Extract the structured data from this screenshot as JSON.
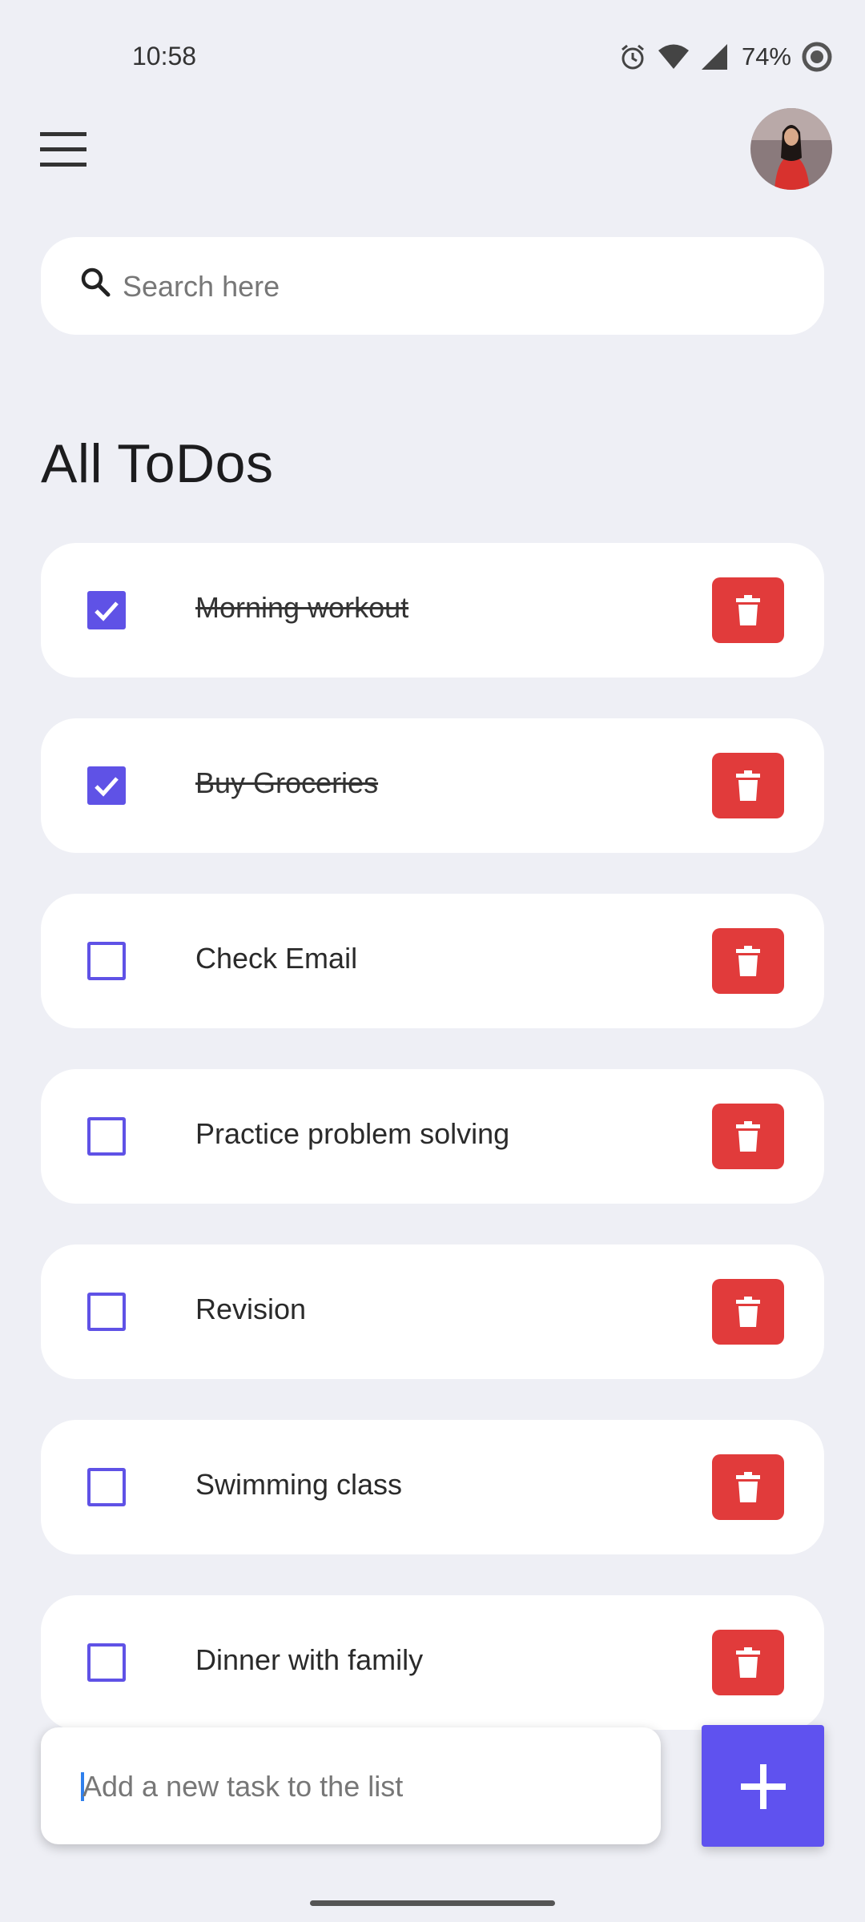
{
  "status_bar": {
    "time": "10:58",
    "battery": "74%",
    "icons": [
      "alarm-icon",
      "wifi-icon",
      "signal-icon",
      "battery-icon"
    ]
  },
  "header": {
    "menu_icon": "hamburger-menu-icon",
    "avatar": "profile-avatar"
  },
  "search": {
    "placeholder": "Search here",
    "value": ""
  },
  "section_title": "All ToDos",
  "todos": [
    {
      "text": "Morning workout",
      "done": true
    },
    {
      "text": "Buy Groceries",
      "done": true
    },
    {
      "text": "Check Email",
      "done": false
    },
    {
      "text": "Practice problem solving",
      "done": false
    },
    {
      "text": "Revision",
      "done": false
    },
    {
      "text": "Swimming class",
      "done": false
    },
    {
      "text": "Dinner with family",
      "done": false
    }
  ],
  "new_task": {
    "placeholder": "Add a new task to the list",
    "value": ""
  },
  "colors": {
    "accent": "#5f52ef",
    "delete": "#e13b3b",
    "background": "#eeeff5"
  }
}
